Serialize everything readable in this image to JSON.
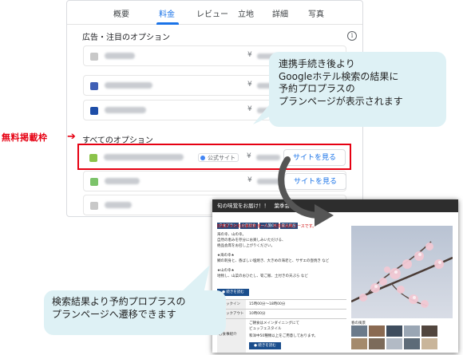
{
  "tabs": [
    "概要",
    "料金",
    "レビュー",
    "立地",
    "詳細",
    "写真"
  ],
  "active_tab": "料金",
  "ads_section_title": "広告・注目のオプション",
  "info_icon_glyph": "i",
  "all_options_title": "すべてのオプション",
  "currency_symbol": "¥",
  "site_button_label": "サイトを見る",
  "official_site_badge": "公式サイト",
  "free_listing_label": "無料掲載枠",
  "callout_top": "連携手続き後より\nGoogleホテル検索の結果に\n予約プロプラスの\nプランページが表示されます",
  "callout_bottom": "検索結果より予約プロプラスの\nプランページへ遷移できます",
  "plan_page": {
    "header_title": "旬の味覚をお届け！！　葉季会",
    "red_text": "四季折々の旬の食材を使った、自慢の会席コースです。",
    "body_lines": [
      "海の幸、山の幸。",
      "自然の恵みを存分にお楽しみいただける、",
      "絶品会席をお召し上がりください。",
      "",
      "★海の幸★",
      "鯛の刺身と、香ばしい塩焼き、大きめの海老と、サザエの壺焼き など",
      "",
      "★山の幸★",
      "地物し、山菜のおひたし、筍ご飯、土付きの天ぷら など"
    ],
    "reserve_button": "● 続きを読む",
    "checkin_label": "チェックイン",
    "checkin_value": "15時00分～18時00分",
    "checkout_label": "チェックアウト",
    "checkout_value": "10時00分",
    "meal_label": "お食事紹介",
    "meal_value_1": "ご朝食はメインダイニングにて",
    "meal_value_2": "ビュッフェスタイル",
    "meal_value_3": "和洋中50種類以上をご用意しております。",
    "photo_caption": "春の風景",
    "tab_tags": [
      "夕食プラン",
      "お部屋食",
      "一人旅OK",
      "露天風呂"
    ]
  }
}
